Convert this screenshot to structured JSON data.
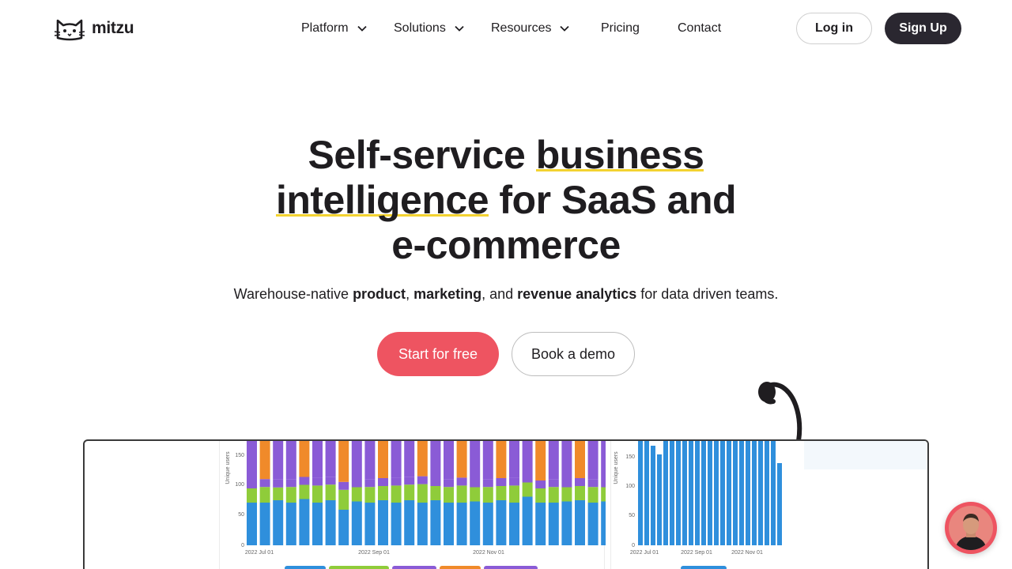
{
  "brand": {
    "name": "mitzu"
  },
  "nav": {
    "items": [
      {
        "label": "Platform",
        "dropdown": true
      },
      {
        "label": "Solutions",
        "dropdown": true
      },
      {
        "label": "Resources",
        "dropdown": true
      },
      {
        "label": "Pricing",
        "dropdown": false
      },
      {
        "label": "Contact",
        "dropdown": false
      }
    ],
    "login_label": "Log in",
    "signup_label": "Sign Up"
  },
  "hero": {
    "title_parts": [
      "Self-service ",
      "business",
      "intelligence",
      " for SaaS and",
      "e-commerce"
    ],
    "subtitle_parts": [
      "Warehouse-native ",
      "product",
      ", ",
      "marketing",
      ", and ",
      "revenue analytics",
      " for data driven teams."
    ],
    "primary_cta": "Start for free",
    "secondary_cta": "Book a demo"
  },
  "colors": {
    "accent": "#ee5461",
    "dark": "#2a2730",
    "underline": "#f3d230",
    "bar_blue": "#2f8fdc",
    "bar_green": "#8fcc3a",
    "bar_purple": "#8a5bd6",
    "bar_orange": "#f08a2a"
  },
  "screenshot": {
    "chart_1": {
      "ylabel": "Unique users",
      "yticks": [
        "0",
        "50",
        "100",
        "150"
      ],
      "xticks": [
        "2022 Jul 01",
        "2022 Sep 01",
        "2022 Nov 01"
      ]
    },
    "chart_2": {
      "ylabel": "Unique users",
      "yticks": [
        "0",
        "50",
        "100",
        "150"
      ],
      "xticks": [
        "2022 Jul 01",
        "2022 Sep 01",
        "2022 Nov 01"
      ]
    }
  },
  "chat": {
    "icon": "chat-avatar-icon"
  }
}
